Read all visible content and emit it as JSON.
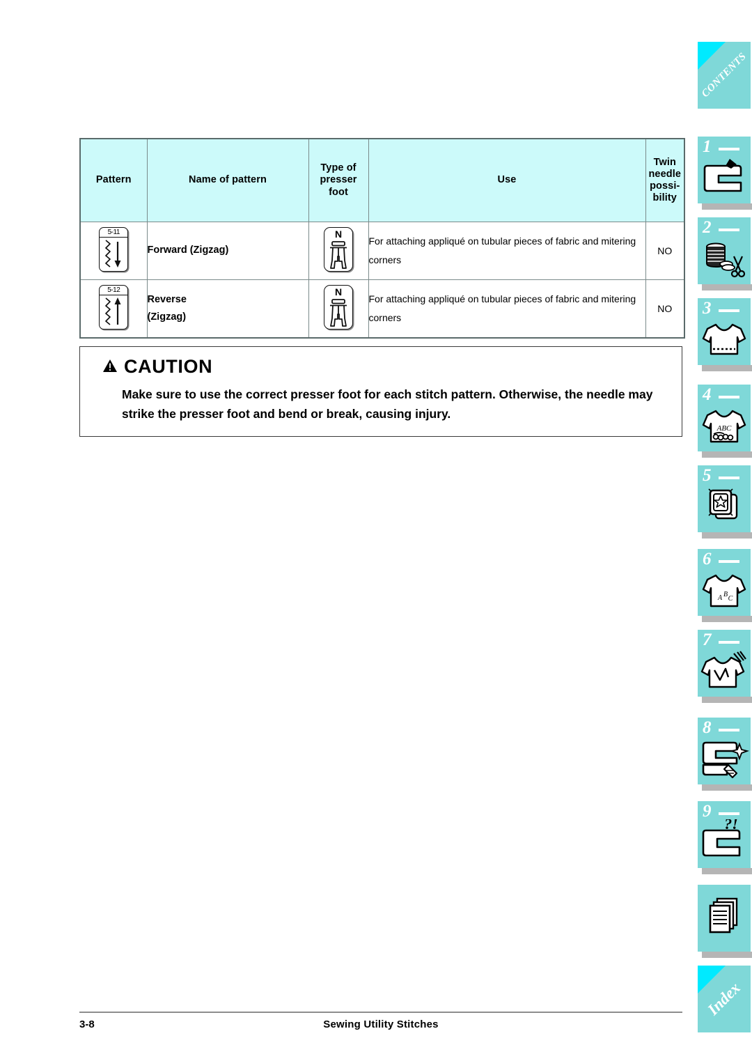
{
  "document": {
    "footer": {
      "page_number": "3-8",
      "section_title": "Sewing Utility Stitches"
    }
  },
  "table": {
    "headers": {
      "pattern": "Pattern",
      "name_of_pattern": "Name of pattern",
      "type_of_presser_foot": "Type of\npresser\nfoot",
      "type_of_presser_foot_lines": [
        "Type of",
        "presser",
        "foot"
      ],
      "use": "Use",
      "twin_needle_possibility_lines": [
        "Twin",
        "needle",
        "possi-",
        "bility"
      ]
    },
    "header_bg": "#CCFAFA",
    "rows": [
      {
        "pattern_code": "5-11",
        "pattern_direction": "down",
        "name_lines": [
          "Forward (Zigzag)"
        ],
        "presser_foot_letter": "N",
        "use": "For attaching appliqué on tubular pieces of fabric and mitering corners",
        "twin_needle": "NO"
      },
      {
        "pattern_code": "5-12",
        "pattern_direction": "up",
        "name_lines": [
          "Reverse",
          "(Zigzag)"
        ],
        "presser_foot_letter": "N",
        "use": "For attaching appliqué on tubular pieces of fabric and mitering corners",
        "twin_needle": "NO"
      }
    ]
  },
  "caution": {
    "icon": "warning-triangle-icon",
    "title": "CAUTION",
    "body": "Make sure to use the correct presser foot for each stitch pattern. Otherwise, the needle may strike the presser foot and bend or break, causing injury."
  },
  "sidebar": {
    "tab_color": "#7FD8D8",
    "corner_color": "#00EAFF",
    "shadow_color": "#B5B5B5",
    "tabs": [
      {
        "label": "CONTENTS",
        "type": "diagonal",
        "icon": "contents-tab"
      },
      {
        "label": "1",
        "type": "numbered",
        "icon": "sewing-machine-icon"
      },
      {
        "label": "2",
        "type": "numbered",
        "icon": "thread-spool-scissors-icon"
      },
      {
        "label": "3",
        "type": "numbered",
        "icon": "shirt-stitch-icon"
      },
      {
        "label": "4",
        "type": "numbered",
        "icon": "shirt-abc-icon"
      },
      {
        "label": "5",
        "type": "numbered",
        "icon": "embroidery-card-star-icon"
      },
      {
        "label": "6",
        "type": "numbered",
        "icon": "shirt-monogram-icon"
      },
      {
        "label": "7",
        "type": "numbered",
        "icon": "shirt-repair-icon"
      },
      {
        "label": "8",
        "type": "numbered",
        "icon": "machine-cleaning-icon"
      },
      {
        "label": "",
        "type": "icon-only",
        "icon": "pages-stack-icon"
      },
      {
        "label": "Index",
        "type": "diagonal",
        "icon": "index-tab"
      }
    ],
    "tab9": {
      "label": "9",
      "icon": "machine-troubleshoot-icon"
    }
  }
}
